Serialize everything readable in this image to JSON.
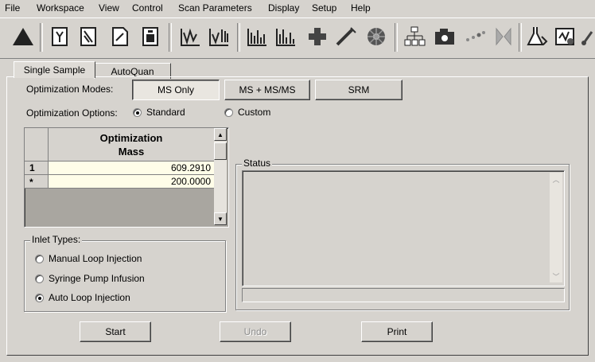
{
  "menu": [
    "File",
    "Workspace",
    "View",
    "Control",
    "Scan Parameters",
    "Display",
    "Setup",
    "Help"
  ],
  "tabs": [
    "Single Sample",
    "AutoQuan"
  ],
  "optimization_modes": {
    "label": "Optimization Modes:",
    "buttons": [
      "MS Only",
      "MS + MS/MS",
      "SRM"
    ],
    "selected": "MS Only"
  },
  "optimization_options": {
    "label": "Optimization Options:",
    "standard": "Standard",
    "custom": "Custom",
    "selected": "Standard"
  },
  "grid": {
    "header_line1": "Optimization",
    "header_line2": "Mass",
    "rows": [
      {
        "marker": "1",
        "value": "609.2910"
      },
      {
        "marker": "*",
        "value": "200.0000"
      }
    ]
  },
  "inlet": {
    "title": "Inlet Types:",
    "options": [
      "Manual Loop Injection",
      "Syringe Pump Infusion",
      "Auto Loop Injection"
    ],
    "selected": "Auto Loop Injection"
  },
  "status": {
    "title": "Status"
  },
  "actions": {
    "start": "Start",
    "undo": "Undo",
    "print": "Print"
  },
  "toolbar_icons": [
    "status-triangle-icon",
    "tune-icon",
    "instrument-icon",
    "document-icon",
    "report-icon",
    "spectrum-icon",
    "spectrum-2-icon",
    "chromatogram-icon",
    "bar-chart-icon",
    "plus-icon",
    "syringe-icon",
    "wheel-icon",
    "flow-diagram-icon",
    "camera-icon",
    "dots-icon",
    "valve-icon",
    "flask-icon",
    "calibrate-icon",
    "probe-icon"
  ]
}
